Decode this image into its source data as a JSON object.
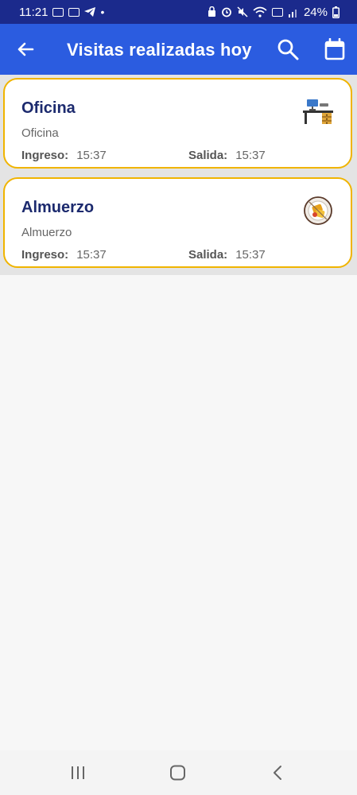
{
  "status_bar": {
    "time": "11:21",
    "battery": "24%"
  },
  "app_bar": {
    "title": "Visitas realizadas hoy"
  },
  "visits": [
    {
      "name": "Oficina",
      "description": "Oficina",
      "in_label": "Ingreso:",
      "in_time": "15:37",
      "out_label": "Salida:",
      "out_time": "15:37",
      "icon": "desk-icon"
    },
    {
      "name": "Almuerzo",
      "description": "Almuerzo",
      "in_label": "Ingreso:",
      "in_time": "15:37",
      "out_label": "Salida:",
      "out_time": "15:37",
      "icon": "lunch-icon"
    }
  ],
  "colors": {
    "status_bar": "#1b2a8c",
    "app_bar": "#2b5ce0",
    "card_border": "#f0b400",
    "title_text": "#1c2a6e"
  }
}
